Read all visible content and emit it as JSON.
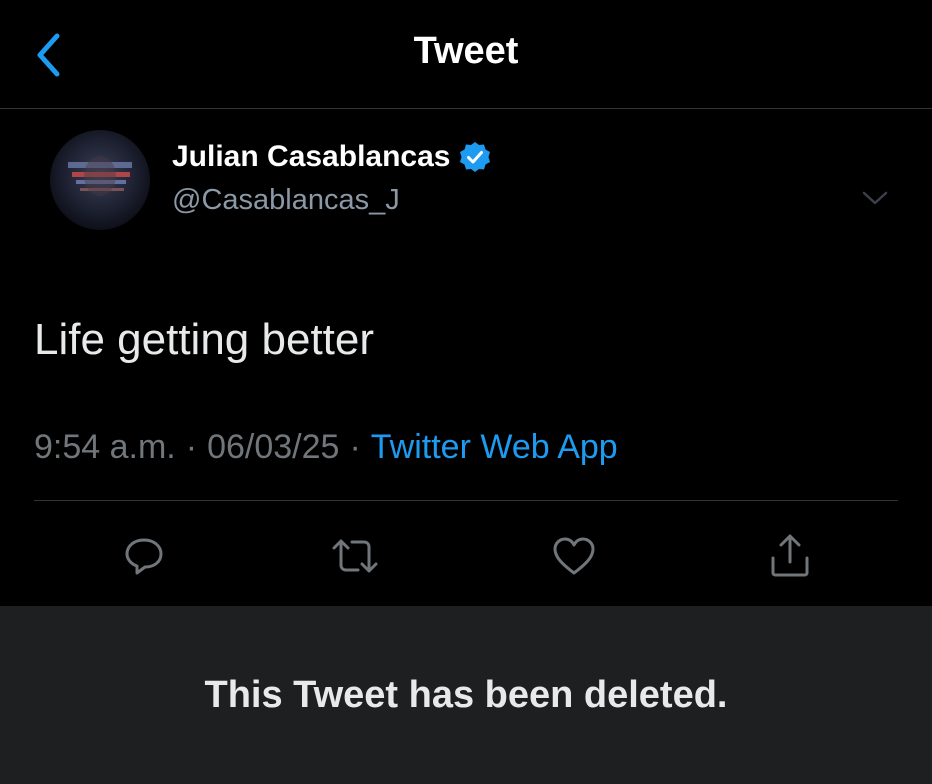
{
  "header": {
    "title": "Tweet",
    "back_icon": "chevron-left-icon"
  },
  "tweet": {
    "author": {
      "name": "Julian Casablancas",
      "handle": "@Casablancas_J",
      "verified": true
    },
    "text": "Life getting better",
    "time": "9:54 a.m.",
    "sep1": "·",
    "date": "06/03/25",
    "sep2": "·",
    "source": "Twitter Web App",
    "actions": [
      "reply-icon",
      "retweet-icon",
      "like-icon",
      "share-icon"
    ]
  },
  "banner": {
    "text": "This Tweet has been deleted."
  },
  "colors": {
    "accent": "#1d9bf0",
    "background": "#000000",
    "muted": "#71767b",
    "banner_bg": "#1e1f21"
  }
}
